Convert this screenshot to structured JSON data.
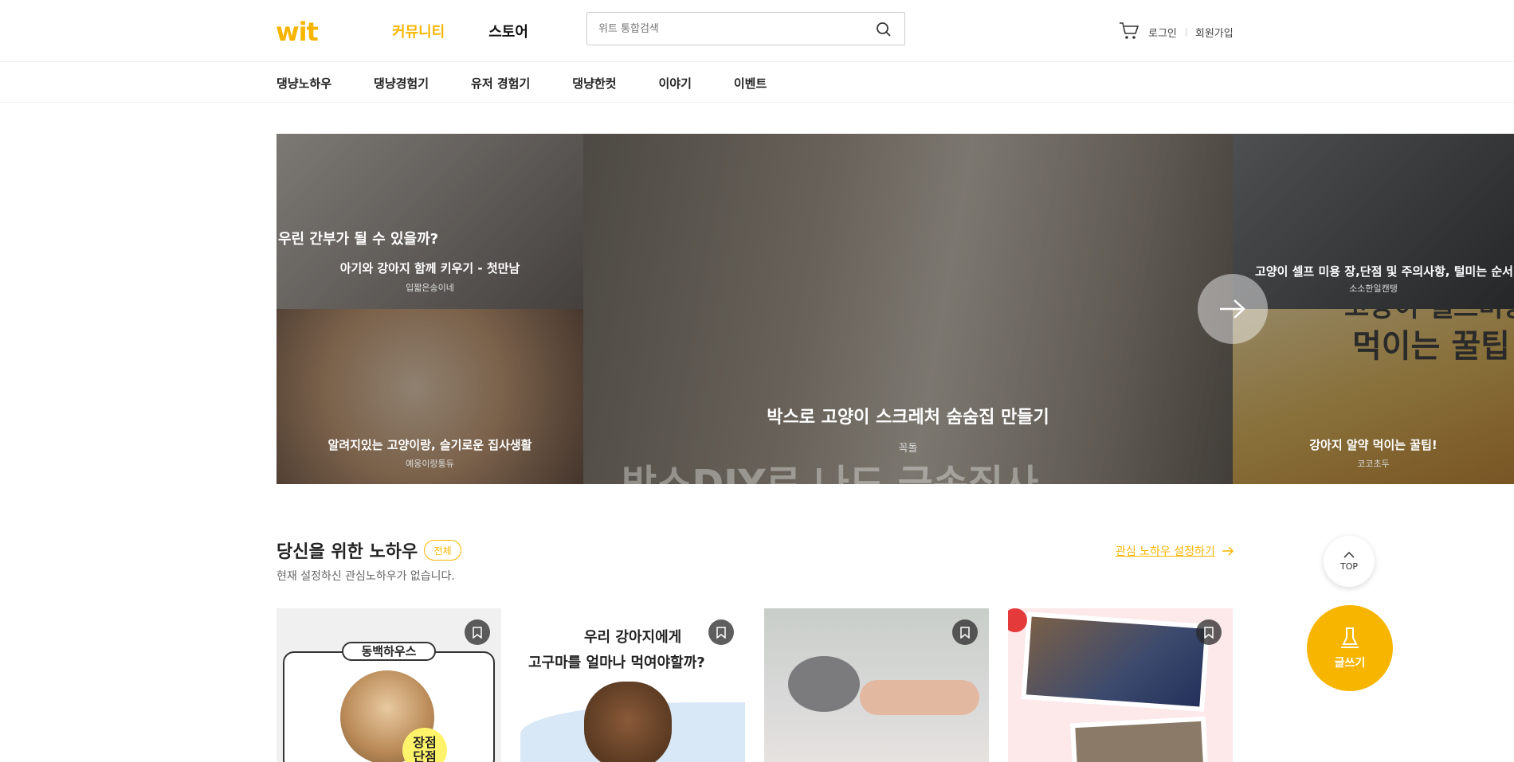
{
  "header": {
    "logo": "wit",
    "nav": [
      {
        "label": "커뮤니티",
        "active": true
      },
      {
        "label": "스토어",
        "active": false
      }
    ],
    "search_placeholder": "위트 통합검색",
    "login": "로그인",
    "signup": "회원가입"
  },
  "subnav": [
    "댕냥노하우",
    "댕냥경험기",
    "유저 경험기",
    "댕냥한컷",
    "이야기",
    "이벤트"
  ],
  "hero": {
    "tiles": [
      {
        "title": "아기와 강아지 함께 키우기 - 첫만남",
        "author": "입짧은송이네",
        "overlay": "우린 간부가 될 수 있을까?"
      },
      {
        "title": "알려지있는 고양이랑, 슬기로운 집사생활",
        "author": "예옹이랑통듀"
      },
      {
        "title": "박스로 고양이 스크레처 숨숨집 만들기",
        "author": "꼭돌",
        "overlay": "박스DIY로 나도 금손집사"
      },
      {
        "title": "고양이 셀프 미용 장,단점 및 주의사항, 털미는 순서",
        "author": "소소한일캔탱"
      },
      {
        "title": "강아지 알약 먹이는 꿀팁!",
        "author": "코코초두",
        "overlay1": "고양이 셀프미용",
        "overlay2": "먹이는 꿀팁!"
      }
    ]
  },
  "section": {
    "title": "당신을 위한 노하우",
    "badge": "전체",
    "subtitle": "현재 설정하신 관심노하우가 없습니다.",
    "link": "관심 노하우 설정하기",
    "cards": [
      {
        "label": "동백하우스",
        "tag1": "장점",
        "tag2": "단점"
      },
      {
        "line1": "우리 강아지에게",
        "line2": "고구마를 얼마나 먹여야할까?"
      },
      {},
      {}
    ]
  },
  "floating": {
    "top": "TOP",
    "write": "글쓰기"
  },
  "colors": {
    "accent": "#f7b500"
  }
}
